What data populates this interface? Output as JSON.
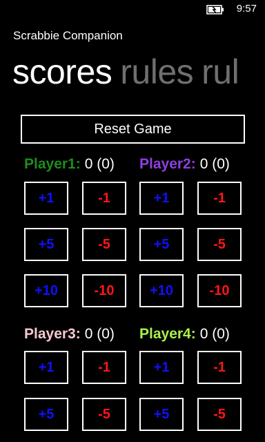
{
  "status_bar": {
    "time": "9:57",
    "battery_icon": "battery-charging-icon"
  },
  "app": {
    "title": "Scrabbie Companion"
  },
  "pivot": {
    "items": [
      "scores",
      "rules",
      "rul"
    ]
  },
  "reset_button": {
    "label": "Reset Game"
  },
  "colors": {
    "player1": "#1e8c1e",
    "player2": "#8f3fe0",
    "player3": "#f7c8d0",
    "player4": "#a8f04a",
    "plus": "#1010ff",
    "minus": "#ff1515"
  },
  "players": [
    {
      "name": "Player1:",
      "score": "0 (0)",
      "buttons": {
        "plus1": "+1",
        "minus1": "-1",
        "plus5": "+5",
        "minus5": "-5",
        "plus10": "+10",
        "minus10": "-10"
      }
    },
    {
      "name": "Player2:",
      "score": "0 (0)",
      "buttons": {
        "plus1": "+1",
        "minus1": "-1",
        "plus5": "+5",
        "minus5": "-5",
        "plus10": "+10",
        "minus10": "-10"
      }
    },
    {
      "name": "Player3:",
      "score": "0 (0)",
      "buttons": {
        "plus1": "+1",
        "minus1": "-1",
        "plus5": "+5",
        "minus5": "-5"
      }
    },
    {
      "name": "Player4:",
      "score": "0 (0)",
      "buttons": {
        "plus1": "+1",
        "minus1": "-1",
        "plus5": "+5",
        "minus5": "-5"
      }
    }
  ]
}
